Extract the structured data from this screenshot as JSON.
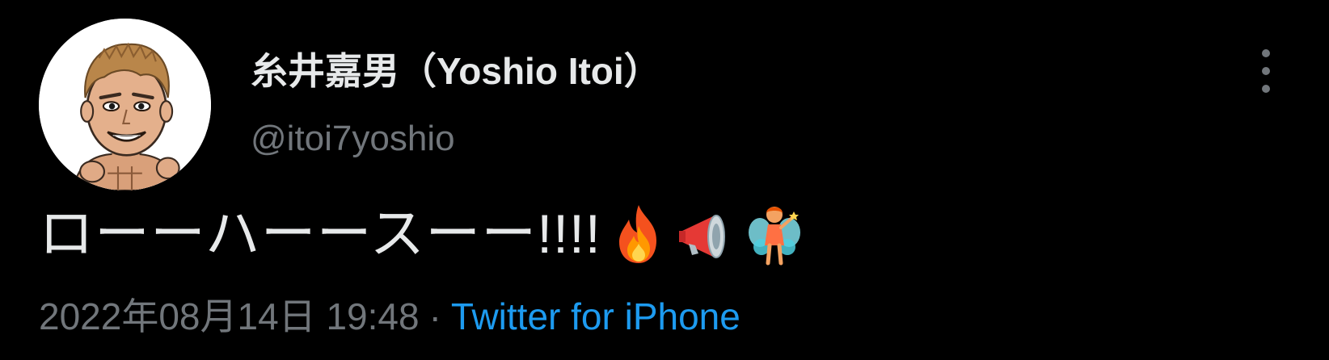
{
  "user": {
    "display_name": "糸井嘉男（Yoshio Itoi）",
    "handle": "@itoi7yoshio",
    "avatar_icon": "cartoon-muscleman-avatar"
  },
  "tweet": {
    "text": "ローーハーースーー!!!!",
    "emojis": [
      "fire-emoji",
      "megaphone-emoji",
      "fairy-emoji"
    ]
  },
  "meta": {
    "timestamp": "2022年08月14日 19:48",
    "separator": "·",
    "source": "Twitter for iPhone"
  },
  "actions": {
    "more_icon": "more-vertical-icon"
  },
  "colors": {
    "background": "#000000",
    "primary_text": "#e7e9ea",
    "secondary_text": "#71767b",
    "link": "#1d9bf0"
  }
}
